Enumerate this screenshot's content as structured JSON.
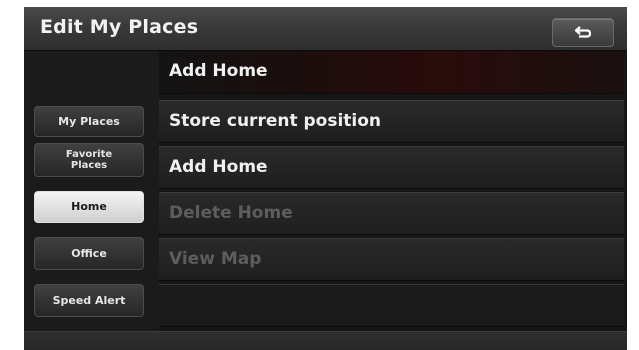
{
  "header": {
    "title": "Edit My Places",
    "back_icon": "back-arrow-icon"
  },
  "sidebar": {
    "items": [
      {
        "label": "My Places",
        "active": false
      },
      {
        "label": "Favorite\nPlaces",
        "active": false
      },
      {
        "label": "Home",
        "active": true
      },
      {
        "label": "Office",
        "active": false
      },
      {
        "label": "Speed Alert",
        "active": false
      }
    ]
  },
  "content": {
    "heading": "Add Home",
    "items": [
      {
        "label": "Store current position",
        "enabled": true
      },
      {
        "label": "Add Home",
        "enabled": true
      },
      {
        "label": "Delete Home",
        "enabled": false
      },
      {
        "label": "View Map",
        "enabled": false
      }
    ]
  },
  "colors": {
    "background": "#161616",
    "active_button": "#e8e8e8",
    "disabled_text": "#5d5d5d"
  }
}
